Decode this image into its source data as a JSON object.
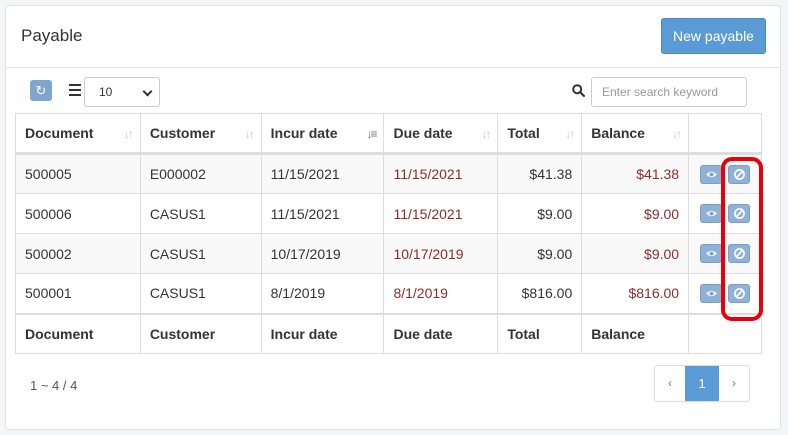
{
  "header": {
    "title": "Payable",
    "new_button": "New payable"
  },
  "toolbar": {
    "page_size": "10",
    "page_size_options": [
      "10"
    ],
    "search_placeholder": "Enter search keyword"
  },
  "table": {
    "columns": [
      "Document",
      "Customer",
      "Incur date",
      "Due date",
      "Total",
      "Balance"
    ],
    "rows": [
      {
        "document": "500005",
        "customer": "E000002",
        "incur_date": "11/15/2021",
        "due_date": "11/15/2021",
        "total": "$41.38",
        "balance": "$41.38"
      },
      {
        "document": "500006",
        "customer": "CASUS1",
        "incur_date": "11/15/2021",
        "due_date": "11/15/2021",
        "total": "$9.00",
        "balance": "$9.00"
      },
      {
        "document": "500002",
        "customer": "CASUS1",
        "incur_date": "10/17/2019",
        "due_date": "10/17/2019",
        "total": "$9.00",
        "balance": "$9.00"
      },
      {
        "document": "500001",
        "customer": "CASUS1",
        "incur_date": "8/1/2019",
        "due_date": "8/1/2019",
        "total": "$816.00",
        "balance": "$816.00"
      }
    ],
    "footer": [
      "Document",
      "Customer",
      "Incur date",
      "Due date",
      "Total",
      "Balance"
    ],
    "row_actions": [
      "eye-icon",
      "ban-icon"
    ]
  },
  "pagination": {
    "info": "1 ~ 4 / 4",
    "prev": "‹",
    "current": "1",
    "next": "›"
  },
  "colors": {
    "accent": "#5b9bd5",
    "due_text": "#8b2c2c",
    "highlight": "#e8000b"
  }
}
